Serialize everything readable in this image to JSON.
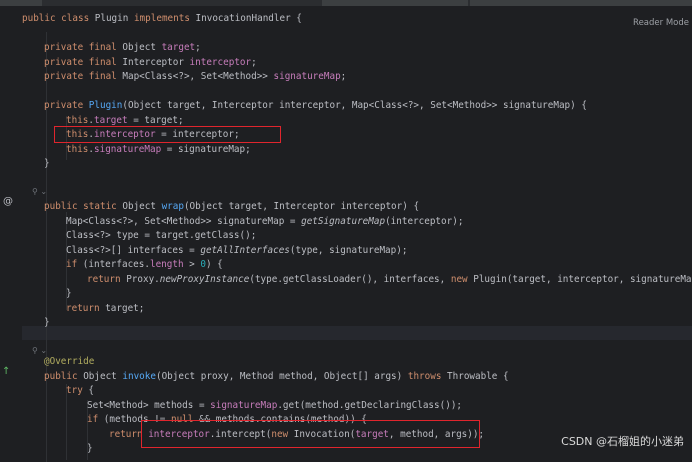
{
  "reader_mode": "Reader Mode",
  "watermark": "CSDN @石榴姐的小迷弟",
  "gutter_icons": {
    "at_icon": "@",
    "override_icon": "↑"
  },
  "code": {
    "l1": [
      "public class ",
      "Plugin ",
      "implements ",
      "InvocationHandler {"
    ],
    "l2": [
      "private final ",
      "Object ",
      "target",
      ";"
    ],
    "l3": [
      "private final ",
      "Interceptor ",
      "interceptor",
      ";"
    ],
    "l4": [
      "private final ",
      "Map<Class<?>, Set<Method>> ",
      "signatureMap",
      ";"
    ],
    "l5": [
      "private ",
      "Plugin",
      "(Object target, Interceptor interceptor, Map<Class<?>, Set<Method>> signatureMap) {"
    ],
    "l6": [
      "this",
      ".",
      "target",
      " = target;"
    ],
    "l7": [
      "this",
      ".",
      "interceptor",
      " = interceptor;"
    ],
    "l8": [
      "this",
      ".",
      "signatureMap",
      " = signatureMap;"
    ],
    "l9": "}",
    "l10": "⚲ ⌄",
    "l11": [
      "public static ",
      "Object ",
      "wrap",
      "(Object target, Interceptor interceptor) {"
    ],
    "l12": [
      "Map<Class<?>, Set<Method>> signatureMap = ",
      "getSignatureMap",
      "(interceptor);"
    ],
    "l13": "Class<?> type = target.getClass();",
    "l14": [
      "Class<?>[] interfaces = ",
      "getAllInterfaces",
      "(type, signatureMap);"
    ],
    "l15": [
      "if ",
      "(interfaces.",
      "length",
      " > ",
      "0",
      ") {"
    ],
    "l16": [
      "return ",
      "Proxy.",
      "newProxyInstance",
      "(type.getClassLoader(), interfaces, ",
      "new ",
      "Plugin(target, interceptor, signatureMap));"
    ],
    "l17": "}",
    "l18": [
      "return ",
      "target;"
    ],
    "l19": "}",
    "l20": "⚲ ⌄",
    "l21": "@Override",
    "l22": [
      "public ",
      "Object ",
      "invoke",
      "(Object proxy, Method method, Object[] args) ",
      "throws ",
      "Throwable {"
    ],
    "l23": [
      "try ",
      "{"
    ],
    "l24": [
      "Set<Method> methods = ",
      "signatureMap",
      ".get(method.getDeclaringClass());"
    ],
    "l25": [
      "if ",
      "(methods != ",
      "null ",
      "&& methods.contains(method)) {"
    ],
    "l26": [
      "return ",
      "interceptor",
      ".intercept(",
      "new ",
      "Invocation(",
      "target",
      ", method, args));"
    ],
    "l27": "}"
  }
}
